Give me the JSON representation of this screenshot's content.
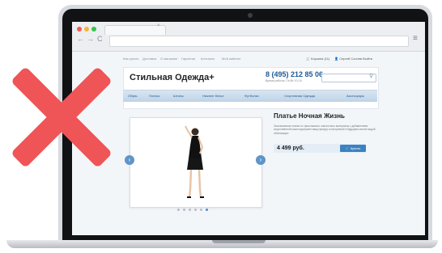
{
  "browser": {
    "back_glyph": "←",
    "forward_glyph": "→",
    "reload_glyph": "C",
    "tab_close": "×",
    "menu_glyph": "≡",
    "traffic_lights": [
      "#f25b52",
      "#f4b637",
      "#35c44a"
    ]
  },
  "site": {
    "top_nav": [
      "Как купить",
      "Доставка",
      "О магазине",
      "Гарантии",
      "Контакты",
      "Мой кабинет"
    ],
    "cart_text": "Корзина (11)",
    "user_text": "Сергей Сочнев Выйти",
    "logo": "Стильная Одежда+",
    "phone": "8 (495) 212 85 06",
    "hours": "Время работы: Пн-Вт 10-18",
    "categories": [
      "Обувь",
      "Платья",
      "Штаны",
      "Нижнее белье",
      "Футболки",
      "Спортивная Одежда",
      "Аксессуары"
    ]
  },
  "product": {
    "title": "Платье Ночная Жизнь",
    "description": "Эксклюзивное платье из трикотажного эластичного материала с добавлением искусственной кожи подчеркнет вашу фигуру и настроение в будущем сезоне модой облегающее",
    "price": "4 499 руб.",
    "buy_label": "Купить",
    "carousel": {
      "count": 6,
      "active": 6
    }
  },
  "colors": {
    "accent": "#3b82c4",
    "phone": "#1e5a97",
    "x_mark": "#ef5457"
  },
  "icons": [
    "x-mark-icon",
    "cart-icon",
    "user-icon",
    "search-icon",
    "arrow-left-icon",
    "arrow-right-icon",
    "menu-icon"
  ]
}
